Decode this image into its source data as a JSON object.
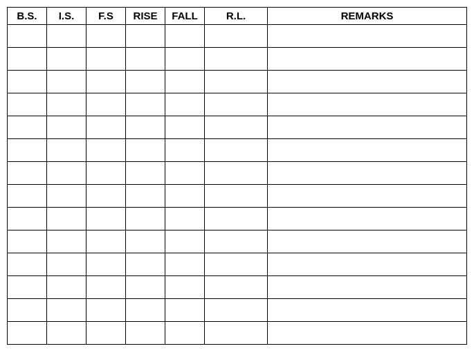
{
  "table": {
    "headers": {
      "bs": "B.S.",
      "is": "I.S.",
      "fs": "F.S",
      "rise": "RISE",
      "fall": "FALL",
      "rl": "R.L.",
      "remarks": "REMARKS"
    },
    "rows": [
      {
        "bs": "",
        "is": "",
        "fs": "",
        "rise": "",
        "fall": "",
        "rl": "",
        "remarks": ""
      },
      {
        "bs": "",
        "is": "",
        "fs": "",
        "rise": "",
        "fall": "",
        "rl": "",
        "remarks": ""
      },
      {
        "bs": "",
        "is": "",
        "fs": "",
        "rise": "",
        "fall": "",
        "rl": "",
        "remarks": ""
      },
      {
        "bs": "",
        "is": "",
        "fs": "",
        "rise": "",
        "fall": "",
        "rl": "",
        "remarks": ""
      },
      {
        "bs": "",
        "is": "",
        "fs": "",
        "rise": "",
        "fall": "",
        "rl": "",
        "remarks": ""
      },
      {
        "bs": "",
        "is": "",
        "fs": "",
        "rise": "",
        "fall": "",
        "rl": "",
        "remarks": ""
      },
      {
        "bs": "",
        "is": "",
        "fs": "",
        "rise": "",
        "fall": "",
        "rl": "",
        "remarks": ""
      },
      {
        "bs": "",
        "is": "",
        "fs": "",
        "rise": "",
        "fall": "",
        "rl": "",
        "remarks": ""
      },
      {
        "bs": "",
        "is": "",
        "fs": "",
        "rise": "",
        "fall": "",
        "rl": "",
        "remarks": ""
      },
      {
        "bs": "",
        "is": "",
        "fs": "",
        "rise": "",
        "fall": "",
        "rl": "",
        "remarks": ""
      },
      {
        "bs": "",
        "is": "",
        "fs": "",
        "rise": "",
        "fall": "",
        "rl": "",
        "remarks": ""
      },
      {
        "bs": "",
        "is": "",
        "fs": "",
        "rise": "",
        "fall": "",
        "rl": "",
        "remarks": ""
      },
      {
        "bs": "",
        "is": "",
        "fs": "",
        "rise": "",
        "fall": "",
        "rl": "",
        "remarks": ""
      },
      {
        "bs": "",
        "is": "",
        "fs": "",
        "rise": "",
        "fall": "",
        "rl": "",
        "remarks": ""
      }
    ]
  }
}
